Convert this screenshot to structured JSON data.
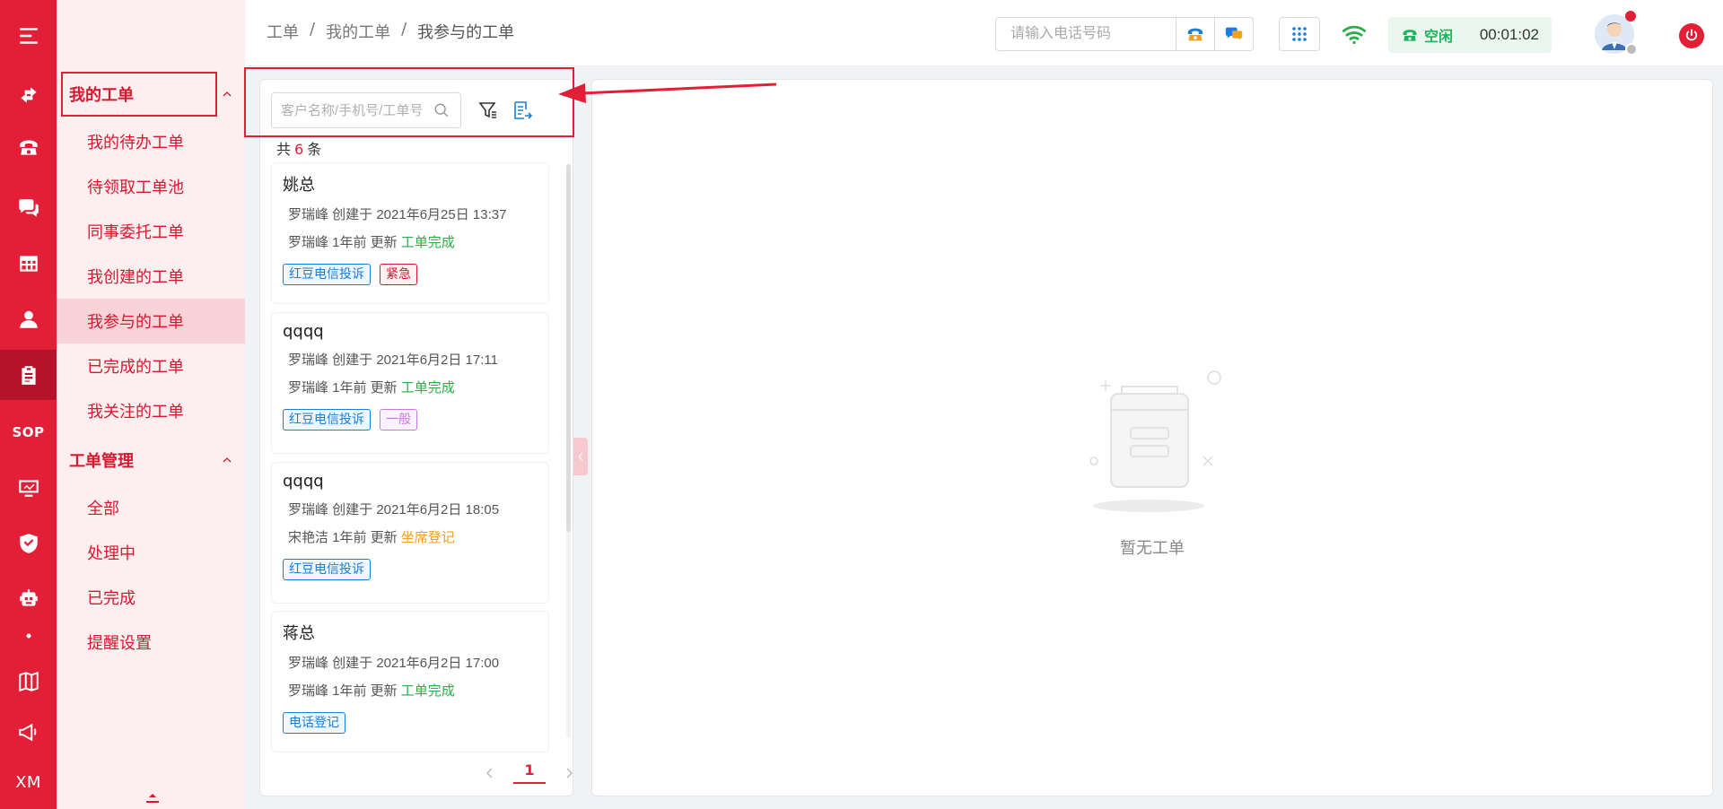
{
  "rail": {
    "items": [
      {
        "icon": "menu-icon"
      },
      {
        "icon": "transfer-icon"
      },
      {
        "icon": "telephone-icon"
      },
      {
        "icon": "chat-icon"
      },
      {
        "icon": "table-icon"
      },
      {
        "icon": "user-icon"
      },
      {
        "icon": "clipboard-icon"
      },
      {
        "label": "SOP"
      },
      {
        "icon": "monitor-icon"
      },
      {
        "icon": "shield-icon"
      },
      {
        "icon": "robot-icon"
      },
      {
        "icon": "dot-icon"
      },
      {
        "icon": "book-icon"
      },
      {
        "icon": "megaphone-icon"
      },
      {
        "label": "XM"
      }
    ],
    "active_icon": "clipboard-icon",
    "bg_color": "#e21f36"
  },
  "submenu": {
    "group1": {
      "label": "我的工单",
      "items": [
        "我的待办工单",
        "待领取工单池",
        "同事委托工单",
        "我创建的工单",
        "我参与的工单",
        "已完成的工单",
        "我关注的工单"
      ],
      "active": "我参与的工单"
    },
    "group2": {
      "label": "工单管理",
      "items": [
        "全部",
        "处理中",
        "已完成",
        "提醒设置"
      ]
    }
  },
  "topbar": {
    "breadcrumb": [
      "工单",
      "我的工单",
      "我参与的工单"
    ],
    "breadcrumb_sep": "/",
    "phone_placeholder": "请输入电话号码",
    "status_label": "空闲",
    "status_time": "00:01:02"
  },
  "list": {
    "search_placeholder": "客户名称/手机号/工单号",
    "total_prefix": "共",
    "total_count": "6",
    "total_suffix": "条",
    "cards": [
      {
        "name": "姚总",
        "created": "罗瑞峰 创建于 2021年6月25日 13:37",
        "updated": "罗瑞峰 1年前 更新",
        "state": "工单完成",
        "state_color": "green",
        "tags": [
          {
            "text": "红豆电信投诉",
            "style": "blue"
          },
          {
            "text": "紧急",
            "style": "red"
          }
        ]
      },
      {
        "name": "qqqq",
        "created": "罗瑞峰 创建于 2021年6月2日 17:11",
        "updated": "罗瑞峰 1年前 更新",
        "state": "工单完成",
        "state_color": "green",
        "tags": [
          {
            "text": "红豆电信投诉",
            "style": "blue"
          },
          {
            "text": "一般",
            "style": "purple"
          }
        ]
      },
      {
        "name": "qqqq",
        "created": "罗瑞峰 创建于 2021年6月2日 18:05",
        "updated": "宋艳洁 1年前 更新",
        "state": "坐席登记",
        "state_color": "orange",
        "tags": [
          {
            "text": "红豆电信投诉",
            "style": "blue"
          }
        ]
      },
      {
        "name": "蒋总",
        "created": "罗瑞峰 创建于 2021年6月2日 17:00",
        "updated": "罗瑞峰 1年前 更新",
        "state": "工单完成",
        "state_color": "green",
        "tags": [
          {
            "text": "电话登记",
            "style": "blue"
          }
        ]
      }
    ],
    "page": "1"
  },
  "detail": {
    "empty_text": "暂无工单"
  }
}
